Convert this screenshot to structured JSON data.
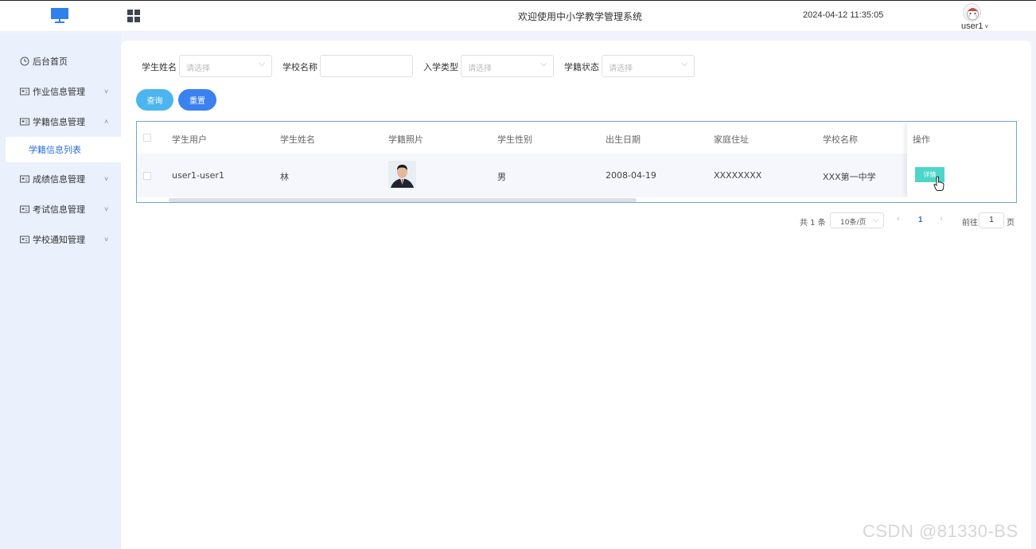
{
  "header": {
    "title": "欢迎使用中小学教学管理系统",
    "datetime": "2024-04-12 11:35:05",
    "user_name": "user1",
    "user_caret": "˅"
  },
  "sidebar": {
    "items": [
      {
        "label": "后台首页",
        "icon": "clock-icon"
      },
      {
        "label": "作业信息管理",
        "icon": "card-icon",
        "chevron": "˅"
      },
      {
        "label": "学籍信息管理",
        "icon": "card-icon",
        "chevron": "˄",
        "expanded": true
      },
      {
        "label": "成绩信息管理",
        "icon": "card-icon",
        "chevron": "˅"
      },
      {
        "label": "考试信息管理",
        "icon": "card-icon",
        "chevron": "˅"
      },
      {
        "label": "学校通知管理",
        "icon": "card-icon",
        "chevron": "˅"
      }
    ],
    "sub_item": {
      "label": "学籍信息列表",
      "active": true
    }
  },
  "filters": {
    "student_name_label": "学生姓名",
    "student_name_placeholder": "请选择",
    "school_name_label": "学校名称",
    "school_name_value": "",
    "enroll_type_label": "入学类型",
    "enroll_type_placeholder": "请选择",
    "status_label": "学籍状态",
    "status_placeholder": "请选择",
    "arrow": "⌵"
  },
  "buttons": {
    "query": "查询",
    "reset": "重置"
  },
  "table": {
    "columns": [
      "学生用户",
      "学生姓名",
      "学籍照片",
      "学生性别",
      "出生日期",
      "家庭住址",
      "学校名称",
      "操作"
    ],
    "rows": [
      {
        "user": "user1-user1",
        "name": "林",
        "gender": "男",
        "birth": "2008-04-19",
        "address": "XXXXXXXX",
        "school": "XXX第一中学",
        "action": "详情"
      }
    ]
  },
  "pagination": {
    "total": "共 1 条",
    "page_size": "10条/页",
    "current_page": "1",
    "goto_label": "前往",
    "goto_value": "1",
    "page_suffix": "页",
    "prev": "‹",
    "next": "›",
    "size_arrow": "⌵"
  },
  "colors": {
    "accent": "#2b6fe0",
    "query_button": "#4cb5ef",
    "reset_button": "#3b82f0",
    "detail_button": "#4dd6c8",
    "sidebar_bg": "#eaf0fc"
  },
  "watermark": "CSDN @81330-BS"
}
